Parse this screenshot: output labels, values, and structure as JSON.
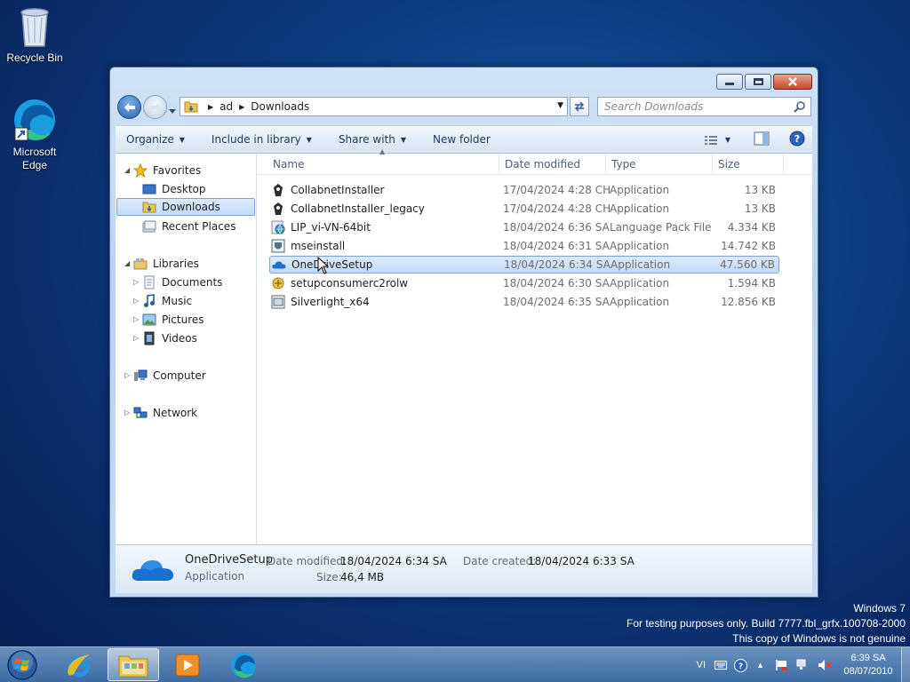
{
  "desktop": {
    "icons": [
      {
        "label": "Recycle Bin",
        "icon": "recycle-bin-icon"
      },
      {
        "label": "Microsoft Edge",
        "icon": "edge-icon"
      }
    ],
    "watermark": {
      "line1": "Windows 7",
      "line2": "For testing purposes only. Build 7777.fbl_grfx.100708-2000",
      "line3": "This copy of Windows is not genuine"
    }
  },
  "explorer": {
    "address": {
      "crumbs": [
        "ad",
        "Downloads"
      ],
      "search_placeholder": "Search Downloads"
    },
    "toolbar": {
      "organize": "Organize",
      "include_in_library": "Include in library",
      "share_with": "Share with",
      "new_folder": "New folder"
    },
    "nav": {
      "favorites": "Favorites",
      "desktop": "Desktop",
      "downloads": "Downloads",
      "recent_places": "Recent Places",
      "libraries": "Libraries",
      "documents": "Documents",
      "music": "Music",
      "pictures": "Pictures",
      "videos": "Videos",
      "computer": "Computer",
      "network": "Network"
    },
    "columns": {
      "name": "Name",
      "date_modified": "Date modified",
      "type": "Type",
      "size": "Size"
    },
    "files": [
      {
        "name": "CollabnetInstaller",
        "date": "17/04/2024 4:28 CH",
        "type": "Application",
        "size": "13 KB",
        "icon": "installer-icon"
      },
      {
        "name": "CollabnetInstaller_legacy",
        "date": "17/04/2024 4:28 CH",
        "type": "Application",
        "size": "13 KB",
        "icon": "installer-icon"
      },
      {
        "name": "LIP_vi-VN-64bit",
        "date": "18/04/2024 6:36 SA",
        "type": "Language Pack File",
        "size": "4.334 KB",
        "icon": "language-pack-icon"
      },
      {
        "name": "mseinstall",
        "date": "18/04/2024 6:31 SA",
        "type": "Application",
        "size": "14.742 KB",
        "icon": "mse-icon"
      },
      {
        "name": "OneDriveSetup",
        "date": "18/04/2024 6:34 SA",
        "type": "Application",
        "size": "47.560 KB",
        "icon": "onedrive-icon",
        "selected": true
      },
      {
        "name": "setupconsumerc2rolw",
        "date": "18/04/2024 6:30 SA",
        "type": "Application",
        "size": "1.594 KB",
        "icon": "office-setup-icon"
      },
      {
        "name": "Silverlight_x64",
        "date": "18/04/2024 6:35 SA",
        "type": "Application",
        "size": "12.856 KB",
        "icon": "silverlight-icon"
      }
    ],
    "details": {
      "name": "OneDriveSetup",
      "type": "Application",
      "date_modified_label": "Date modified:",
      "date_modified": "18/04/2024 6:34 SA",
      "size_label": "Size:",
      "size": "46,4 MB",
      "date_created_label": "Date created:",
      "date_created": "18/04/2024 6:33 SA"
    }
  },
  "taskbar": {
    "language": "VI",
    "time": "6:39 SA",
    "date": "08/07/2010"
  }
}
